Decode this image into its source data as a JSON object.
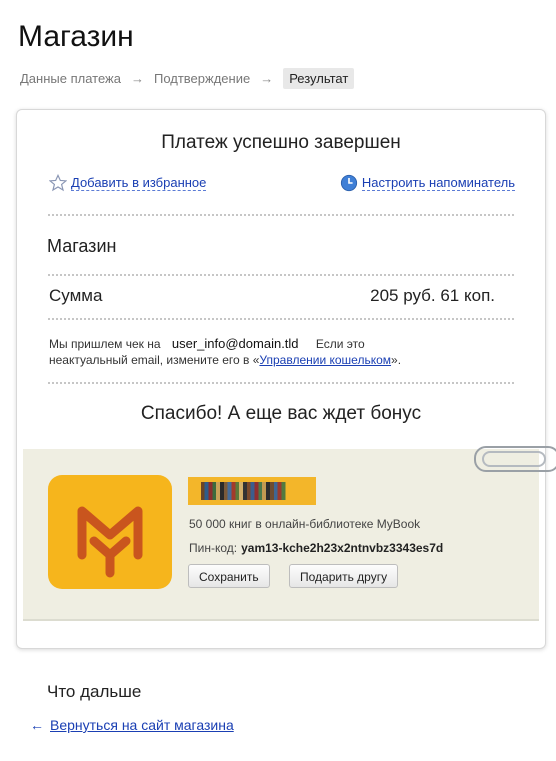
{
  "page": {
    "title": "Магазин"
  },
  "breadcrumbs": [
    {
      "label": "Данные платежа"
    },
    {
      "label": "Подтверждение"
    },
    {
      "label": "Результат"
    }
  ],
  "breadcrumb_arrow": "→",
  "card": {
    "title": "Платеж успешно завершен",
    "add_favorite": "Добавить в избранное",
    "set_reminder": "Настроить напоминатель",
    "merchant": "Магазин",
    "sum_label": "Сумма",
    "sum_value": "205 руб. 61 коп.",
    "receipt_prefix": "Мы пришлем чек на",
    "receipt_email": "user_info@domain.tld",
    "receipt_if": "Если это",
    "receipt_line2_prefix": "неактуальный email, измените его в «",
    "wallet_link": "Управлении кошельком",
    "receipt_line2_suffix": "».",
    "thanks": "Спасибо! А еще вас ждет бонус"
  },
  "bonus": {
    "description": "50 000 книг в онлайн-библиотеке MyBook",
    "pin_label": "Пин-код:",
    "pin_code": "yam13-kche2h23x2ntnvbz3343es7d",
    "save_button": "Сохранить",
    "gift_button": "Подарить другу",
    "brand_color": "#f6b51c",
    "logo_icon": "mybook-logo-icon"
  },
  "next": {
    "heading": "Что дальше",
    "back_arrow": "←",
    "back_link": "Вернуться на сайт магазина"
  },
  "colors": {
    "link": "#1a3fb3",
    "bonus_bg": "#efeee2"
  }
}
